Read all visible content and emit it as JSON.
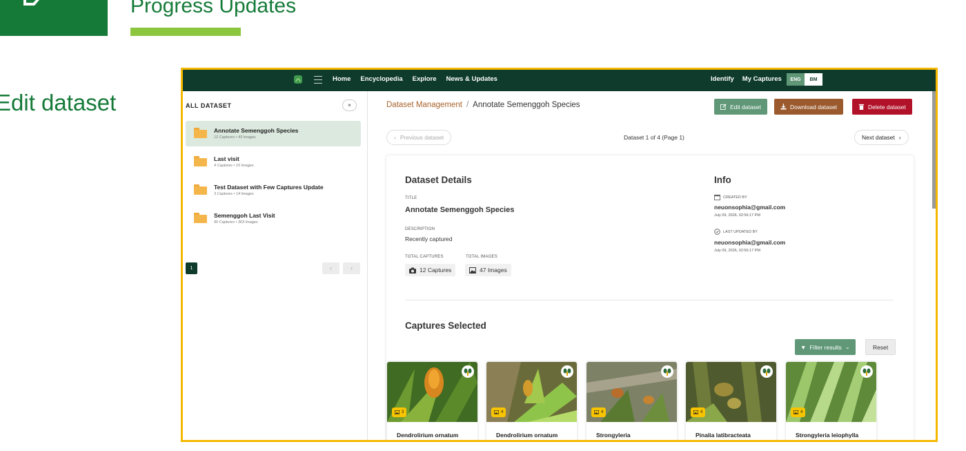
{
  "slide": {
    "title": "Progress Updates",
    "subtitle": "Edit dataset",
    "colors": {
      "brand_green": "#157a38",
      "accent_lime": "#8cc63f",
      "highlight_border": "#f5b800"
    }
  },
  "app": {
    "nav": {
      "links": [
        "Home",
        "Encyclopedia",
        "Explore",
        "News & Updates"
      ],
      "right_links": [
        "Identify",
        "My Captures"
      ],
      "lang": {
        "eng": "ENG",
        "bm": "BM",
        "selected": "ENG"
      },
      "colors": {
        "bar": "#0e3b2c"
      }
    },
    "sidebar": {
      "heading": "ALL DATASET",
      "close_label": "×",
      "items": [
        {
          "name": "Annotate Semenggoh Species",
          "meta": "12 Captures • 43 Images",
          "active": true
        },
        {
          "name": "Last visit",
          "meta": "4 Captures • 15 Images",
          "active": false
        },
        {
          "name": "Test Dataset with Few Captures Update",
          "meta": "3 Captures • 14 Images",
          "active": false
        },
        {
          "name": "Semenggoh Last Visit",
          "meta": "90 Captures • 363 Images",
          "active": false
        }
      ],
      "page": "1",
      "prev_label": "‹",
      "next_label": "›"
    },
    "main": {
      "breadcrumb": {
        "root": "Dataset Management",
        "sep": "/",
        "current": "Annotate Semenggoh Species"
      },
      "actions": {
        "edit": "Edit dataset",
        "download": "Download dataset",
        "delete": "Delete dataset",
        "colors": {
          "edit": "#5f9777",
          "download": "#9a5a2e",
          "delete": "#b1122a"
        }
      },
      "pager": {
        "prev": "Previous dataset",
        "next": "Next dataset",
        "counter": "Dataset 1 of 4 (Page 1)"
      },
      "details": {
        "heading": "Dataset Details",
        "title_label": "TITLE",
        "title": "Annotate Semenggoh Species",
        "description_label": "DESCRIPTION",
        "description": "Recently captured",
        "total_captures_label": "TOTAL CAPTURES",
        "total_captures": "12 Captures",
        "total_images_label": "TOTAL IMAGES",
        "total_images": "47 Images"
      },
      "info": {
        "heading": "Info",
        "created_by_label": "CREATED BY",
        "created_by": "neuonsophia@gmail.com",
        "created_at": "July 09, 2026, 02:56:17 PM",
        "updated_by_label": "LAST UPDATED BY",
        "updated_by": "neuonsophia@gmail.com",
        "updated_at": "July 09, 2026, 02:56:17 PM"
      },
      "captures": {
        "heading": "Captures Selected",
        "filter_label": "Filter results",
        "reset_label": "Reset",
        "items": [
          {
            "name": "Dendrolirium ornatum",
            "images": "3"
          },
          {
            "name": "Dendrolirium ornatum",
            "images": "4"
          },
          {
            "name": "Strongyleria",
            "images": "4"
          },
          {
            "name": "Pinalia latibracteata",
            "images": "4"
          },
          {
            "name": "Strongyleria leiophylla",
            "images": "4"
          }
        ]
      }
    }
  }
}
